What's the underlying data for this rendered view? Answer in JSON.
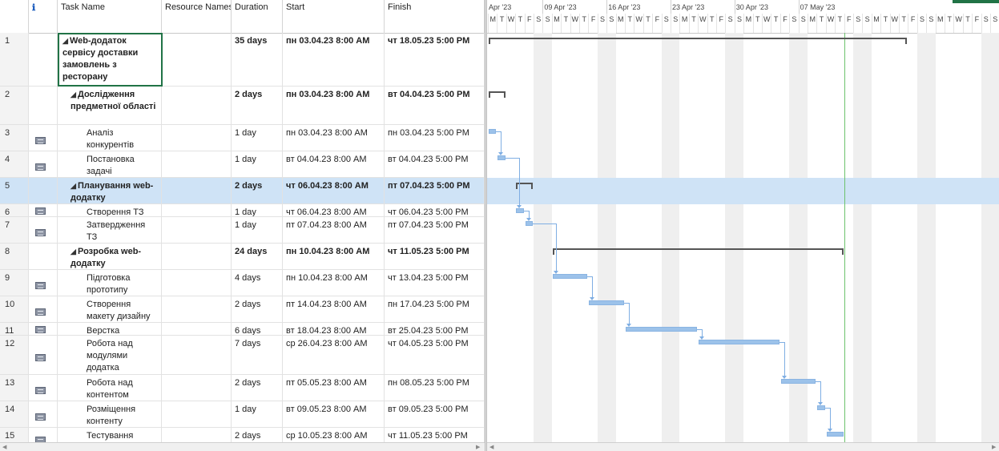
{
  "columns": {
    "id": "",
    "indicator": "ℹ",
    "name": "Task Name",
    "resources": "Resource Names",
    "duration": "Duration",
    "start": "Start",
    "finish": "Finish"
  },
  "timescale": {
    "weeks": [
      "Apr '23",
      "09 Apr '23",
      "16 Apr '23",
      "23 Apr '23",
      "30 Apr '23",
      "07 May '23"
    ],
    "days": [
      "M",
      "T",
      "W",
      "T",
      "F",
      "S",
      "S",
      "M",
      "T",
      "W",
      "T",
      "F",
      "S",
      "S",
      "M",
      "T",
      "W",
      "T",
      "F",
      "S",
      "S",
      "M",
      "T",
      "W",
      "T",
      "F",
      "S",
      "S",
      "M",
      "T",
      "W",
      "T",
      "F",
      "S",
      "S",
      "M",
      "T",
      "W",
      "T",
      "F",
      "S",
      "S",
      "M",
      "T",
      "W",
      "T",
      "F",
      "S",
      "S",
      "M",
      "T",
      "W",
      "T",
      "F",
      "S",
      "S"
    ]
  },
  "tasks": [
    {
      "id": "1",
      "name": "Web-додаток сервісу доставки замовлень з ресторану",
      "summary": true,
      "level": 0,
      "duration": "35 days",
      "start": "пн 03.04.23 8:00 AM",
      "finish": "чт 18.05.23 5:00 PM"
    },
    {
      "id": "2",
      "name": "Дослідження предметної області",
      "summary": true,
      "level": 1,
      "duration": "2 days",
      "start": "пн 03.04.23 8:00 AM",
      "finish": "вт 04.04.23 5:00 PM"
    },
    {
      "id": "3",
      "name": "Аналіз конкурентів",
      "summary": false,
      "level": 2,
      "duration": "1 day",
      "start": "пн 03.04.23 8:00 AM",
      "finish": "пн 03.04.23 5:00 PM"
    },
    {
      "id": "4",
      "name": "Постановка задачі",
      "summary": false,
      "level": 2,
      "duration": "1 day",
      "start": "вт 04.04.23 8:00 AM",
      "finish": "вт 04.04.23 5:00 PM"
    },
    {
      "id": "5",
      "name": "Планування web-додатку",
      "summary": true,
      "level": 1,
      "duration": "2 days",
      "start": "чт 06.04.23 8:00 AM",
      "finish": "пт 07.04.23 5:00 PM"
    },
    {
      "id": "6",
      "name": "Створення ТЗ",
      "summary": false,
      "level": 2,
      "duration": "1 day",
      "start": "чт 06.04.23 8:00 AM",
      "finish": "чт 06.04.23 5:00 PM"
    },
    {
      "id": "7",
      "name": "Затвердження ТЗ",
      "summary": false,
      "level": 2,
      "duration": "1 day",
      "start": "пт 07.04.23 8:00 AM",
      "finish": "пт 07.04.23 5:00 PM"
    },
    {
      "id": "8",
      "name": "Розробка web-додатку",
      "summary": true,
      "level": 1,
      "duration": "24 days",
      "start": "пн 10.04.23 8:00 AM",
      "finish": "чт 11.05.23 5:00 PM"
    },
    {
      "id": "9",
      "name": "Підготовка прототипу",
      "summary": false,
      "level": 2,
      "duration": "4 days",
      "start": "пн 10.04.23 8:00 AM",
      "finish": "чт 13.04.23 5:00 PM"
    },
    {
      "id": "10",
      "name": "Створення макету дизайну",
      "summary": false,
      "level": 2,
      "duration": "2 days",
      "start": "пт 14.04.23 8:00 AM",
      "finish": "пн 17.04.23 5:00 PM"
    },
    {
      "id": "11",
      "name": "Верстка",
      "summary": false,
      "level": 2,
      "duration": "6 days",
      "start": "вт 18.04.23 8:00 AM",
      "finish": "вт 25.04.23 5:00 PM"
    },
    {
      "id": "12",
      "name": "Робота над модулями додатка",
      "summary": false,
      "level": 2,
      "duration": "7 days",
      "start": "ср 26.04.23 8:00 AM",
      "finish": "чт 04.05.23 5:00 PM"
    },
    {
      "id": "13",
      "name": "Робота над контентом",
      "summary": false,
      "level": 2,
      "duration": "2 days",
      "start": "пт 05.05.23 8:00 AM",
      "finish": "пн 08.05.23 5:00 PM"
    },
    {
      "id": "14",
      "name": "Розміщення контенту",
      "summary": false,
      "level": 2,
      "duration": "1 day",
      "start": "вт 09.05.23 8:00 AM",
      "finish": "вт 09.05.23 5:00 PM"
    },
    {
      "id": "15",
      "name": "Тестування",
      "summary": false,
      "level": 2,
      "duration": "2 days",
      "start": "ср 10.05.23 8:00 AM",
      "finish": "чт 11.05.23 5:00 PM"
    }
  ],
  "selected_task_id": "5",
  "colors": {
    "bar": "#9cc2ea",
    "selection": "#cfe3f6",
    "summary": "#555555",
    "today": "#6cc26c",
    "nonworking": "#efefef"
  }
}
